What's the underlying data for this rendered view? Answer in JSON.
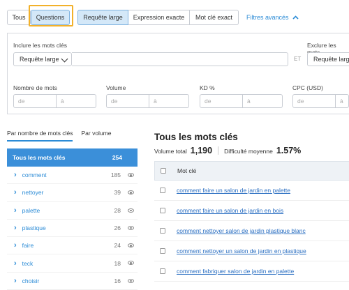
{
  "match_tabs": {
    "all": "Tous",
    "questions": "Questions"
  },
  "match_types": {
    "broad": "Requête large",
    "phrase": "Expression exacte",
    "exact": "Mot clé exact"
  },
  "advanced_filters": "Filtres avancés",
  "filters": {
    "include_label": "Inclure les mots clés",
    "include_mode": "Requête large",
    "et_label": "ET",
    "exclude_label": "Exclure les mots",
    "exclude_mode": "Requête large",
    "word_count_label": "Nombre de mots",
    "volume_label": "Volume",
    "kd_label": "KD %",
    "cpc_label": "CPC (USD)",
    "from_placeholder": "de",
    "to_placeholder": "à"
  },
  "sidebar": {
    "tabs": [
      "Par nombre de mots clés",
      "Par volume"
    ],
    "header": {
      "label": "Tous les mots clés",
      "count": "254"
    },
    "items": [
      {
        "label": "comment",
        "count": "185"
      },
      {
        "label": "nettoyer",
        "count": "39"
      },
      {
        "label": "palette",
        "count": "28"
      },
      {
        "label": "plastique",
        "count": "26"
      },
      {
        "label": "faire",
        "count": "24"
      },
      {
        "label": "teck",
        "count": "18"
      },
      {
        "label": "choisir",
        "count": "16"
      }
    ]
  },
  "main": {
    "title": "Tous les mots clés",
    "total_volume_label": "Volume total",
    "total_volume": "1,190",
    "avg_difficulty_label": "Difficulté moyenne",
    "avg_difficulty": "1.57%",
    "column_keyword": "Mot clé",
    "rows": [
      "comment faire un salon de jardin en palette",
      "comment faire un salon de jardin en bois",
      "comment nettoyer salon de jardin plastique blanc",
      "comment nettoyer un salon de jardin en plastique",
      "comment fabriquer salon de jardin en palette"
    ]
  }
}
